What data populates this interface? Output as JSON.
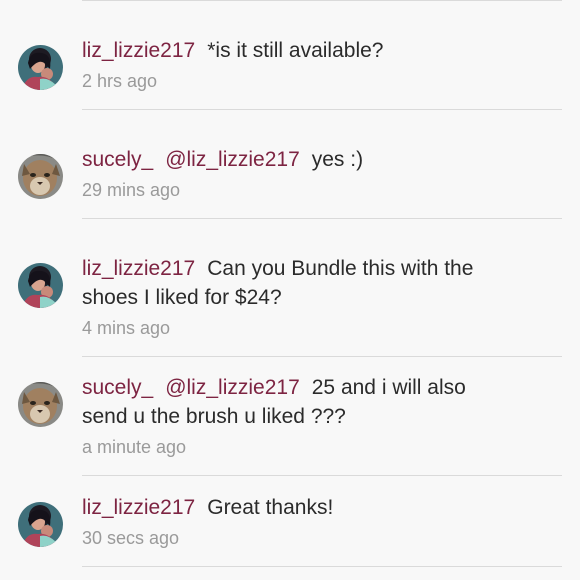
{
  "comments": [
    {
      "user": "liz_lizzie217",
      "avatar": "woman-portrait-avatar",
      "mention": "",
      "lines": [
        "*is it still available?"
      ],
      "time": "2 hrs ago"
    },
    {
      "user": "sucely_",
      "avatar": "cougar-avatar",
      "mention": "@liz_lizzie217",
      "lines": [
        "yes :)"
      ],
      "time": "29 mins ago"
    },
    {
      "user": "liz_lizzie217",
      "avatar": "woman-portrait-avatar",
      "mention": "",
      "lines": [
        "Can you Bundle this with the",
        "shoes I liked for $24?"
      ],
      "time": "4 mins ago"
    },
    {
      "user": "sucely_",
      "avatar": "cougar-avatar",
      "mention": "@liz_lizzie217",
      "lines": [
        "25 and i will also",
        "send u the brush u liked  ???"
      ],
      "time": "a minute ago"
    },
    {
      "user": "liz_lizzie217",
      "avatar": "woman-portrait-avatar",
      "mention": "",
      "lines": [
        "Great thanks!"
      ],
      "time": "30 secs ago"
    }
  ],
  "colors": {
    "username": "#7d2442",
    "text": "#2b2b2b",
    "timestamp": "#9a9a9a",
    "divider": "#dadada",
    "background": "#f8f8f8"
  }
}
